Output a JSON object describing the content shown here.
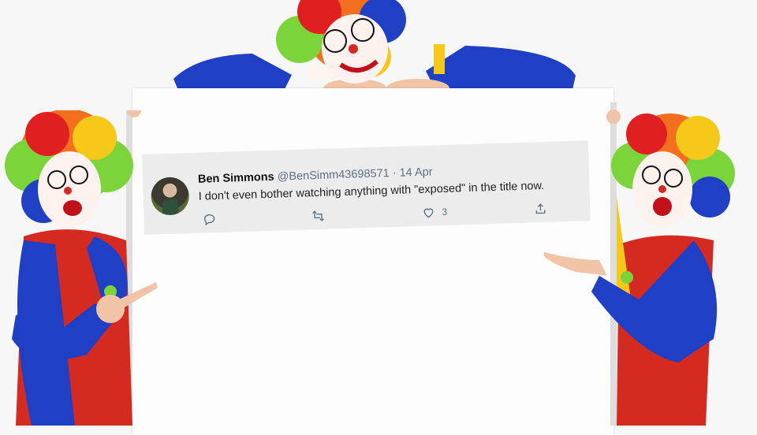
{
  "tweet": {
    "name": "Ben Simmons",
    "handle": "@BenSimm43698571",
    "separator": "·",
    "date": "14 Apr",
    "text": "I don't even bother watching anything with \"exposed\" in the title now.",
    "actions": {
      "reply_icon": "reply-icon",
      "retweet_icon": "retweet-icon",
      "like_icon": "heart-icon",
      "like_count": "3",
      "share_icon": "share-icon"
    }
  },
  "colors": {
    "clown_blue": "#1f3fc4",
    "clown_red": "#d52a1f",
    "wig_yellow": "#f6c81a",
    "wig_green": "#7bd43a",
    "wig_orange": "#f2701d",
    "icon_gray": "#5b7083"
  }
}
